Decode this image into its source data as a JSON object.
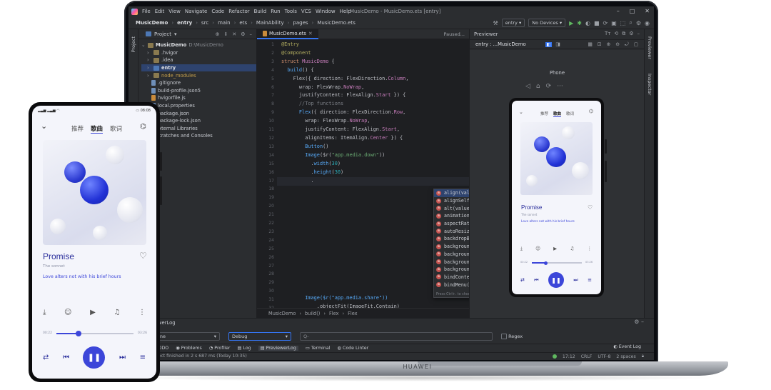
{
  "ide": {
    "menu": [
      "File",
      "Edit",
      "View",
      "Navigate",
      "Code",
      "Refactor",
      "Build",
      "Run",
      "Tools",
      "VCS",
      "Window",
      "Help"
    ],
    "window_title": "MusicDemo - MusicDemo.ets [entry]",
    "breadcrumb": [
      "MusicDemo",
      "entry",
      "src",
      "main",
      "ets",
      "MainAbility",
      "pages",
      "MusicDemo.ets"
    ],
    "run_config": "entry",
    "device": "No Devices",
    "project_panel": {
      "title": "Project",
      "root_name": "MusicDemo",
      "root_path": "D:\\MusicDemo",
      "items": [
        {
          "label": ".hvigor",
          "kind": "folder"
        },
        {
          "label": ".idea",
          "kind": "folder"
        },
        {
          "label": "entry",
          "kind": "folder-blue"
        },
        {
          "label": "node_modules",
          "kind": "folder"
        },
        {
          "label": ".gitignore",
          "kind": "file"
        },
        {
          "label": "build-profile.json5",
          "kind": "file"
        },
        {
          "label": "hvigorfile.js",
          "kind": "file"
        },
        {
          "label": "local.properties",
          "kind": "file"
        },
        {
          "label": "package.json",
          "kind": "file"
        },
        {
          "label": "package-lock.json",
          "kind": "file"
        },
        {
          "label": "External Libraries",
          "kind": "lib"
        },
        {
          "label": "Scratches and Consoles",
          "kind": "lib"
        }
      ]
    },
    "editor": {
      "tab": "MusicDemo.ets",
      "status": "Paused...",
      "line_numbers": [
        "1",
        "2",
        "3",
        "4",
        "5",
        "6",
        "7",
        "8",
        "9",
        "10",
        "11",
        "12",
        "13",
        "14",
        "15",
        "16",
        "17",
        "18",
        "19",
        "20",
        "21",
        "22",
        "23",
        "24",
        "25",
        "26",
        "27",
        "28",
        "29",
        "30",
        "31",
        "32"
      ],
      "code_bottom": [
        "Image($r(\"app.media.share\"))",
        "  .objectFit(ImageFit.Contain)"
      ],
      "suggestions": [
        "align(value: Alignment): ImageAttribute",
        "alignSelf(value: ItemAlign): ImageAttribute",
        "alt(value: string | Resource): ImageAttribute",
        "animation(value: AnimateParam): ImageAttribute",
        "aspectRatio(value: number): ImageAttribute",
        "autoResize(value: boolean): ImageAttribute",
        "backdropBlur(value: number): ImageAttribute",
        "backgroundColor(value: ResourceColor): ImageA...",
        "backgroundImage(src: ResourceStr, repeat?: Im...",
        "backgroundImagePosition(value: Position | Ali...",
        "backgroundImageSize(value: SizeOptions | Imag...",
        "bindContextMenu(content: CustomBuilder, respo...",
        "bindMenu(content: CustomBuilder | {      value..."
      ],
      "hint_text": "Press Ctrl+. to choose the selected (or first) suggestion and ins...",
      "hint_link": "Next Tip",
      "footer_crumbs": [
        "MusicDemo",
        "build()",
        "Flex",
        "Flex"
      ]
    },
    "previewer": {
      "title": "Previewer",
      "route": "entry : ...MusicDemo",
      "device_label": "Phone"
    },
    "right_strip": [
      "Previewer",
      "Inspector"
    ],
    "log": {
      "title": "PreviewerLog",
      "device_select": "None",
      "level_select": "Debug",
      "search_placeholder": "Q-",
      "regex_label": "Regex"
    },
    "bottom_tabs": [
      "TODO",
      "Problems",
      "Profiler",
      "Log",
      "PreviewerLog",
      "Terminal",
      "Code Linter"
    ],
    "event_log": "Event Log",
    "status_message": "Project finished in 2 s 687 ms (Today 10:35)",
    "status_right": [
      "17:12",
      "CRLF",
      "UTF-8",
      "2 spaces"
    ]
  },
  "laptop_brand": "HUAWEI",
  "music_app": {
    "time": "08:08",
    "tabs": [
      "推荐",
      "歌曲",
      "歌词"
    ],
    "selected_tab": 1,
    "song_title": "Promise",
    "artist": "The sonnet",
    "description": "Love alters not with his brief hours",
    "current_time": "00:22",
    "total_time": "03:26",
    "progress": 0.28
  }
}
